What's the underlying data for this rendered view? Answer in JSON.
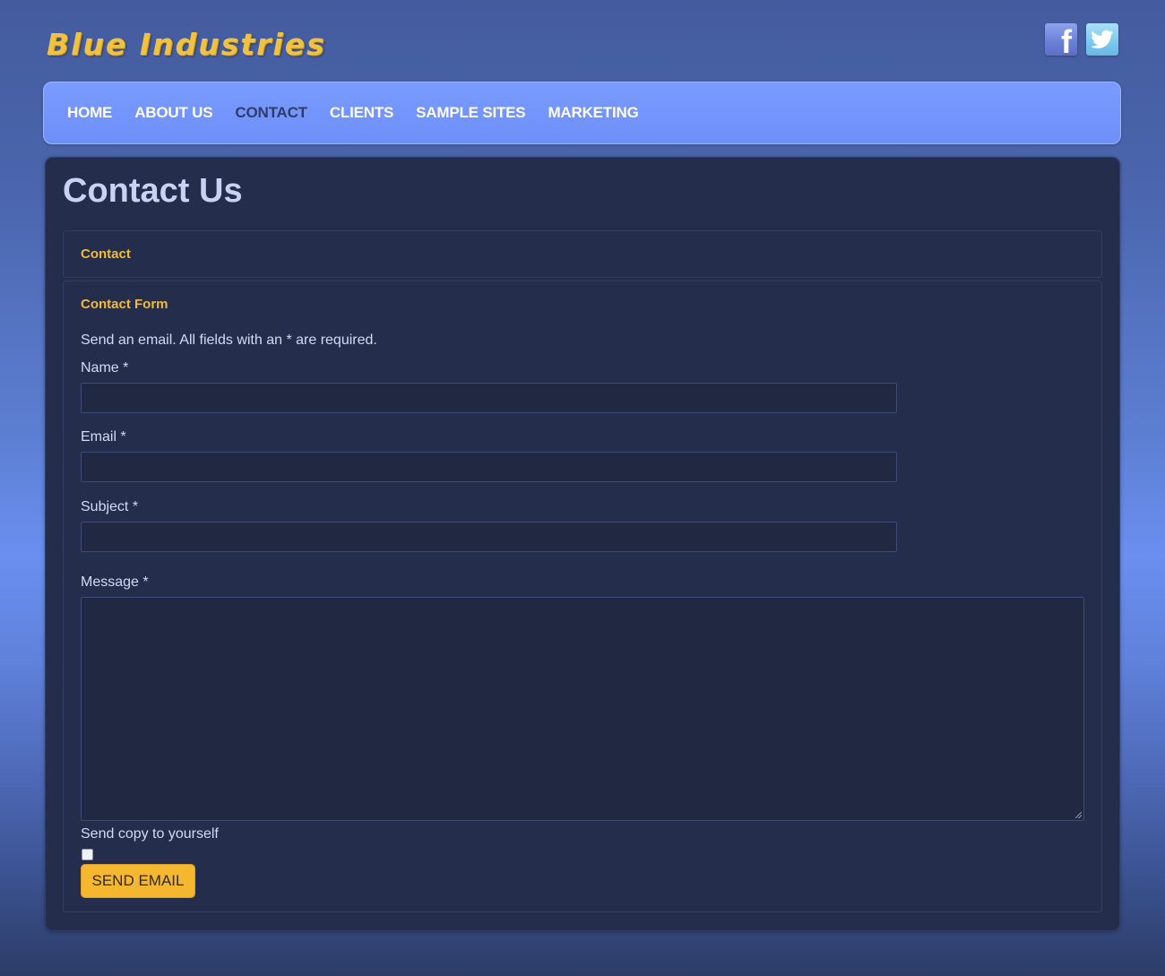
{
  "site": {
    "logo": "Blue Industries",
    "social": {
      "facebook_glyph": "f",
      "twitter_icon": "twitter-bird"
    }
  },
  "nav": {
    "items": [
      {
        "label": "HOME",
        "active": false
      },
      {
        "label": "ABOUT US",
        "active": false
      },
      {
        "label": "CONTACT",
        "active": true
      },
      {
        "label": "CLIENTS",
        "active": false
      },
      {
        "label": "SAMPLE SITES",
        "active": false
      },
      {
        "label": "MARKETING",
        "active": false
      }
    ]
  },
  "main": {
    "title": "Contact Us",
    "contact_heading": "Contact",
    "form": {
      "heading": "Contact Form",
      "intro": "Send an email. All fields with an * are required.",
      "name_label": "Name *",
      "name_value": "",
      "email_label": "Email *",
      "email_value": "",
      "subject_label": "Subject *",
      "subject_value": "",
      "message_label": "Message *",
      "message_value": "",
      "copy_label": "Send copy to yourself",
      "copy_checked": false,
      "submit_label": "SEND EMAIL"
    }
  },
  "colors": {
    "accent": "#f5b730",
    "nav_bg": "#7a9bff",
    "content_bg": "#252d4c",
    "heading": "#f3b93a"
  }
}
